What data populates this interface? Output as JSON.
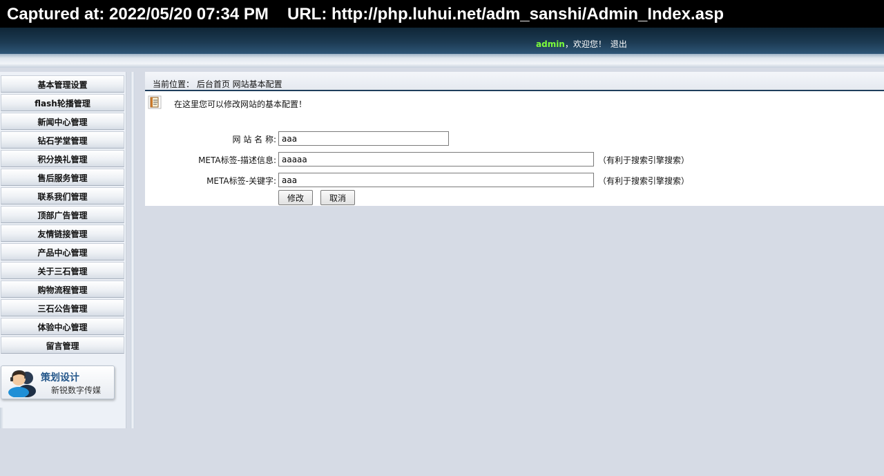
{
  "capture": {
    "captured_at": "Captured at: 2022/05/20 07:34 PM",
    "url": "URL: http://php.luhui.net/adm_sanshi/Admin_Index.asp"
  },
  "header": {
    "username": "admin",
    "welcome": "，欢迎您！",
    "logout": "退出"
  },
  "sidebar": {
    "items": [
      {
        "label": "基本管理设置"
      },
      {
        "label": "flash轮播管理"
      },
      {
        "label": "新闻中心管理"
      },
      {
        "label": "钻石学堂管理"
      },
      {
        "label": "积分换礼管理"
      },
      {
        "label": "售后服务管理"
      },
      {
        "label": "联系我们管理"
      },
      {
        "label": "顶部广告管理"
      },
      {
        "label": "友情链接管理"
      },
      {
        "label": "产品中心管理"
      },
      {
        "label": "关于三石管理"
      },
      {
        "label": "购物流程管理"
      },
      {
        "label": "三石公告管理"
      },
      {
        "label": "体验中心管理"
      },
      {
        "label": "留言管理"
      }
    ],
    "promo": {
      "title": "策划设计",
      "subtitle": "新锐数字传媒"
    }
  },
  "main": {
    "breadcrumb": "当前位置： 后台首页 网站基本配置",
    "intro": "在这里您可以修改网站的基本配置！",
    "form": {
      "site_name_label": "网 站 名 称:",
      "site_name_value": "aaa",
      "meta_desc_label": "META标签-描述信息:",
      "meta_desc_value": "aaaaa",
      "meta_desc_hint": "（有利于搜索引擎搜索）",
      "meta_kw_label": "META标签-关键字:",
      "meta_kw_value": "aaa",
      "meta_kw_hint": "（有利于搜索引擎搜索）",
      "submit_label": "修改",
      "cancel_label": "取消"
    }
  }
}
